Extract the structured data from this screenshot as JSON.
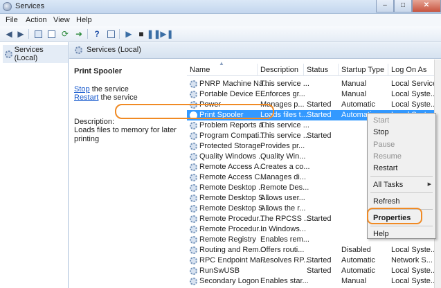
{
  "window": {
    "title": "Services",
    "buttons": [
      "–",
      "□",
      "✕"
    ]
  },
  "menu": [
    "File",
    "Action",
    "View",
    "Help"
  ],
  "toolbar_icons": [
    "back-icon",
    "forward-icon",
    "show-hide-console-tree-icon",
    "list-icon",
    "refresh-icon",
    "export-icon",
    "help-icon",
    "properties-icon",
    "play-icon",
    "stop-icon",
    "pause-icon",
    "restart-icon"
  ],
  "tree": {
    "root": "Services (Local)"
  },
  "pane": {
    "header": "Services (Local)"
  },
  "details": {
    "service_name": "Print Spooler",
    "stop_link": "Stop",
    "stop_suffix": " the service",
    "restart_link": "Restart",
    "restart_suffix": " the service",
    "description_label": "Description:",
    "description": "Loads files to memory for later printing"
  },
  "columns": [
    "Name",
    "Description",
    "Status",
    "Startup Type",
    "Log On As"
  ],
  "rows": [
    {
      "name": "PNRP Machine Na...",
      "desc": "This service ...",
      "status": "",
      "startup": "Manual",
      "logon": "Local Service"
    },
    {
      "name": "Portable Device E...",
      "desc": "Enforces gr...",
      "status": "",
      "startup": "Manual",
      "logon": "Local Syste..."
    },
    {
      "name": "Power",
      "desc": "Manages p...",
      "status": "Started",
      "startup": "Automatic",
      "logon": "Local Syste..."
    },
    {
      "name": "Print Spooler",
      "desc": "Loads files t...",
      "status": "Started",
      "startup": "Automatic",
      "logon": "Local Syste..."
    },
    {
      "name": "Problem Reports a...",
      "desc": "This service ...",
      "status": "",
      "startup": "",
      "logon": ""
    },
    {
      "name": "Program Compati...",
      "desc": "This service ...",
      "status": "Started",
      "startup": "",
      "logon": ""
    },
    {
      "name": "Protected Storage",
      "desc": "Provides pr...",
      "status": "",
      "startup": "",
      "logon": ""
    },
    {
      "name": "Quality Windows ...",
      "desc": "Quality Win...",
      "status": "",
      "startup": "",
      "logon": ""
    },
    {
      "name": "Remote Access A...",
      "desc": "Creates a co...",
      "status": "",
      "startup": "",
      "logon": ""
    },
    {
      "name": "Remote Access C...",
      "desc": "Manages di...",
      "status": "",
      "startup": "",
      "logon": ""
    },
    {
      "name": "Remote Desktop ...",
      "desc": "Remote Des...",
      "status": "",
      "startup": "",
      "logon": ""
    },
    {
      "name": "Remote Desktop S...",
      "desc": "Allows user...",
      "status": "",
      "startup": "",
      "logon": ""
    },
    {
      "name": "Remote Desktop S...",
      "desc": "Allows the r...",
      "status": "",
      "startup": "",
      "logon": ""
    },
    {
      "name": "Remote Procedur...",
      "desc": "The RPCSS ...",
      "status": "Started",
      "startup": "",
      "logon": ""
    },
    {
      "name": "Remote Procedur...",
      "desc": "In Windows...",
      "status": "",
      "startup": "",
      "logon": ""
    },
    {
      "name": "Remote Registry",
      "desc": "Enables rem...",
      "status": "",
      "startup": "",
      "logon": ""
    },
    {
      "name": "Routing and Rem...",
      "desc": "Offers routi...",
      "status": "",
      "startup": "Disabled",
      "logon": "Local Syste..."
    },
    {
      "name": "RPC Endpoint Ma...",
      "desc": "Resolves RP...",
      "status": "Started",
      "startup": "Automatic",
      "logon": "Network S..."
    },
    {
      "name": "RunSwUSB",
      "desc": "",
      "status": "Started",
      "startup": "Automatic",
      "logon": "Local Syste..."
    },
    {
      "name": "Secondary Logon",
      "desc": "Enables star...",
      "status": "",
      "startup": "Manual",
      "logon": "Local Syste..."
    }
  ],
  "context_menu": {
    "start": "Start",
    "stop": "Stop",
    "pause": "Pause",
    "resume": "Resume",
    "restart": "Restart",
    "all_tasks": "All Tasks",
    "refresh": "Refresh",
    "properties": "Properties",
    "help": "Help"
  },
  "colors": {
    "selection": "#3399ff",
    "annotation": "#f08a24",
    "link": "#1155cc"
  }
}
